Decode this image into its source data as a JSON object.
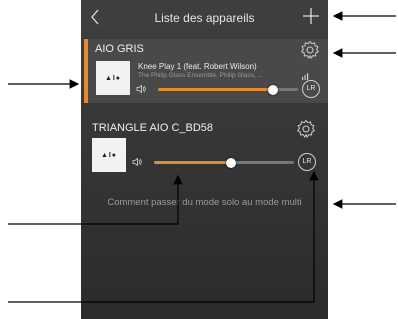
{
  "header": {
    "title": "Liste des appareils"
  },
  "devices": [
    {
      "name": "AIO GRIS",
      "track": "Knee Play 1 (feat. Robert Wilson)",
      "artist": "The Philip Glass Ensemble, Philip Glass, ...",
      "album_text": "▲I●",
      "volume": 0.82,
      "lr_label": "LR"
    },
    {
      "name": "TRIANGLE AIO C_BD58",
      "album_text": "▲I●",
      "volume": 0.55,
      "lr_label": "LR"
    }
  ],
  "solo_text": "Comment passer du mode solo au mode multi",
  "colors": {
    "accent": "#e58a2e",
    "panel": "#3a3a3a"
  },
  "icons": [
    "back-icon",
    "plus-icon",
    "gear-icon",
    "volume-icon",
    "equalizer-icon"
  ]
}
